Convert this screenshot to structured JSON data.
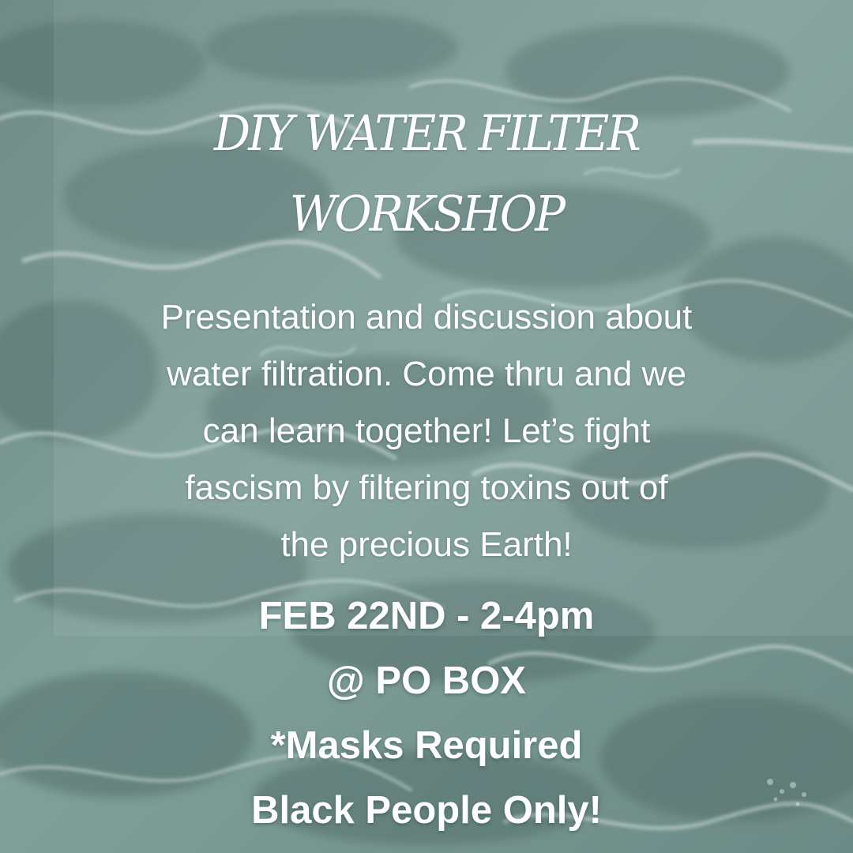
{
  "colors": {
    "water_base": "#7c9893",
    "water_dark": "#5e7a76",
    "highlight": "#c9d8d3",
    "text": "#ffffff"
  },
  "flyer": {
    "title_lines": [
      "DIY WATER FILTER",
      "WORKSHOP"
    ],
    "description_lines": [
      "Presentation and discussion about",
      "water filtration. Come thru and we",
      "can learn together! Let’s fight",
      "fascism by filtering toxins out of",
      "the precious Earth!"
    ],
    "date_time": "FEB 22ND - 2-4pm",
    "location": "@ PO BOX",
    "mask_note": "*Masks Required",
    "audience_note": "Black People Only!"
  }
}
